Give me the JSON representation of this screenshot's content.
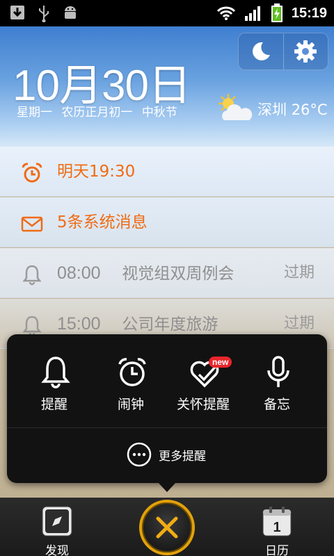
{
  "status_bar": {
    "time": "15:19",
    "icons": [
      "download-icon",
      "usb-icon",
      "android-icon",
      "wifi-icon",
      "signal-icon",
      "battery-charging-icon"
    ]
  },
  "header": {
    "big_date": "10月30日",
    "weekday": "星期一",
    "lunar_date": "农历正月初一",
    "festival": "中秋节",
    "weather": {
      "icon": "partly-sunny-icon",
      "city": "深圳",
      "temperature": "26°C"
    },
    "buttons": [
      "night-mode-icon",
      "settings-gear-icon"
    ]
  },
  "list": {
    "alarm_row": {
      "text": "明天19:30",
      "icon": "alarm-clock-icon"
    },
    "message_row": {
      "text": "5条系统消息",
      "icon": "mail-icon"
    },
    "reminders": [
      {
        "time": "08:00",
        "title": "视觉组双周例会",
        "status": "过期",
        "icon": "bell-icon"
      },
      {
        "time": "15:00",
        "title": "公司年度旅游",
        "status": "过期",
        "icon": "bell-icon"
      }
    ]
  },
  "popup": {
    "items": [
      {
        "label": "提醒",
        "icon": "bell-icon"
      },
      {
        "label": "闹钟",
        "icon": "alarm-clock-icon"
      },
      {
        "label": "关怀提醒",
        "icon": "heart-check-icon",
        "badge": "new"
      },
      {
        "label": "备忘",
        "icon": "microphone-icon"
      }
    ],
    "more_label": "更多提醒",
    "more_icon": "more-dots-icon"
  },
  "bottom_bar": {
    "discover_label": "发现",
    "discover_icon": "compass-icon",
    "calendar_label": "日历",
    "calendar_icon": "calendar-icon",
    "calendar_day": "1",
    "close_icon": "close-icon"
  },
  "colors": {
    "accent_orange": "#f06b14",
    "close_ring": "#e3a20b",
    "badge_red": "#e8262c"
  }
}
